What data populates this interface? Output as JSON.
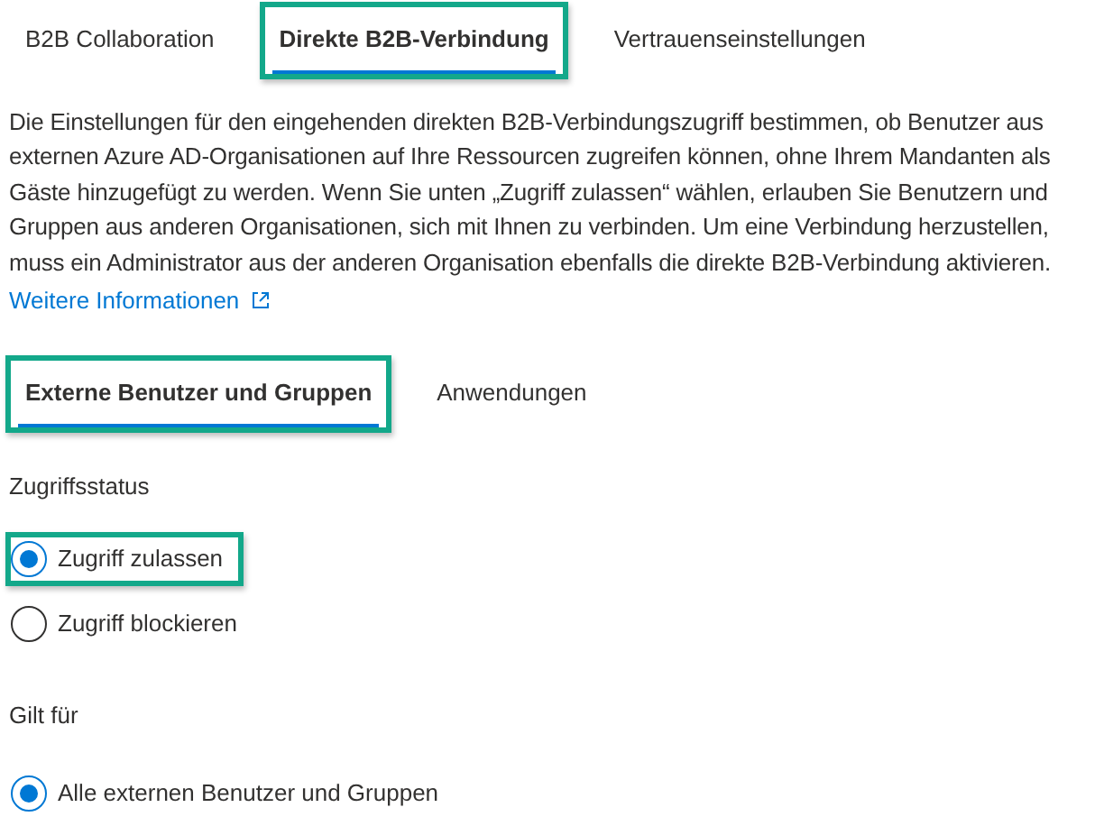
{
  "tabs": [
    {
      "label": "B2B Collaboration",
      "selected": false,
      "highlighted": false
    },
    {
      "label": "Direkte B2B-Verbindung",
      "selected": true,
      "highlighted": true
    },
    {
      "label": "Vertrauenseinstellungen",
      "selected": false,
      "highlighted": false
    }
  ],
  "description": "Die Einstellungen für den eingehenden direkten B2B-Verbindungszugriff bestimmen, ob Benutzer aus externen Azure AD-Organisationen auf Ihre Ressourcen zugreifen können, ohne Ihrem Mandanten als Gäste hinzugefügt zu werden. Wenn Sie unten „Zugriff zulassen“ wählen, erlauben Sie Benutzern und Gruppen aus anderen Organisationen, sich mit Ihnen zu verbinden. Um eine Verbindung herzustellen, muss ein Administrator aus der anderen Organisation ebenfalls die direkte B2B-Verbindung aktivieren.",
  "more_link": "Weitere Informationen",
  "subtabs": [
    {
      "label": "Externe Benutzer und Gruppen",
      "selected": true,
      "highlighted": true
    },
    {
      "label": "Anwendungen",
      "selected": false,
      "highlighted": false
    }
  ],
  "access_status": {
    "label": "Zugriffsstatus",
    "options": [
      {
        "label": "Zugriff zulassen",
        "selected": true,
        "highlighted": true
      },
      {
        "label": "Zugriff blockieren",
        "selected": false,
        "highlighted": false
      }
    ]
  },
  "applies_to": {
    "label": "Gilt für",
    "options": [
      {
        "label": "Alle externen Benutzer und Gruppen",
        "selected": true,
        "highlighted": false
      }
    ]
  }
}
